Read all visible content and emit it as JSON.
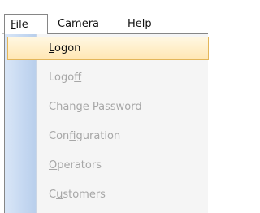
{
  "menubar": {
    "items": [
      {
        "pre": "",
        "mn": "F",
        "post": "ile"
      },
      {
        "pre": "",
        "mn": "C",
        "post": "amera"
      },
      {
        "pre": "",
        "mn": "H",
        "post": "elp"
      }
    ]
  },
  "file_menu": {
    "items": [
      {
        "pre": "",
        "mn": "L",
        "post": "ogon",
        "enabled": true,
        "highlighted": true
      },
      {
        "pre": "Logo",
        "mn": "f",
        "post": "f",
        "enabled": false,
        "highlighted": false
      },
      {
        "pre": "",
        "mn": "C",
        "post": "hange Password",
        "enabled": false,
        "highlighted": false
      },
      {
        "pre": "Con",
        "mn": "f",
        "post": "iguration",
        "enabled": false,
        "highlighted": false
      },
      {
        "pre": "",
        "mn": "O",
        "post": "perators",
        "enabled": false,
        "highlighted": false
      },
      {
        "pre": "C",
        "mn": "u",
        "post": "stomers",
        "enabled": false,
        "highlighted": false
      }
    ]
  },
  "colors": {
    "highlight_fill": "#ffeec8",
    "highlight_border": "#e3b65a",
    "disabled_text": "#a7a7a7",
    "gutter": "#c5d8f1"
  }
}
